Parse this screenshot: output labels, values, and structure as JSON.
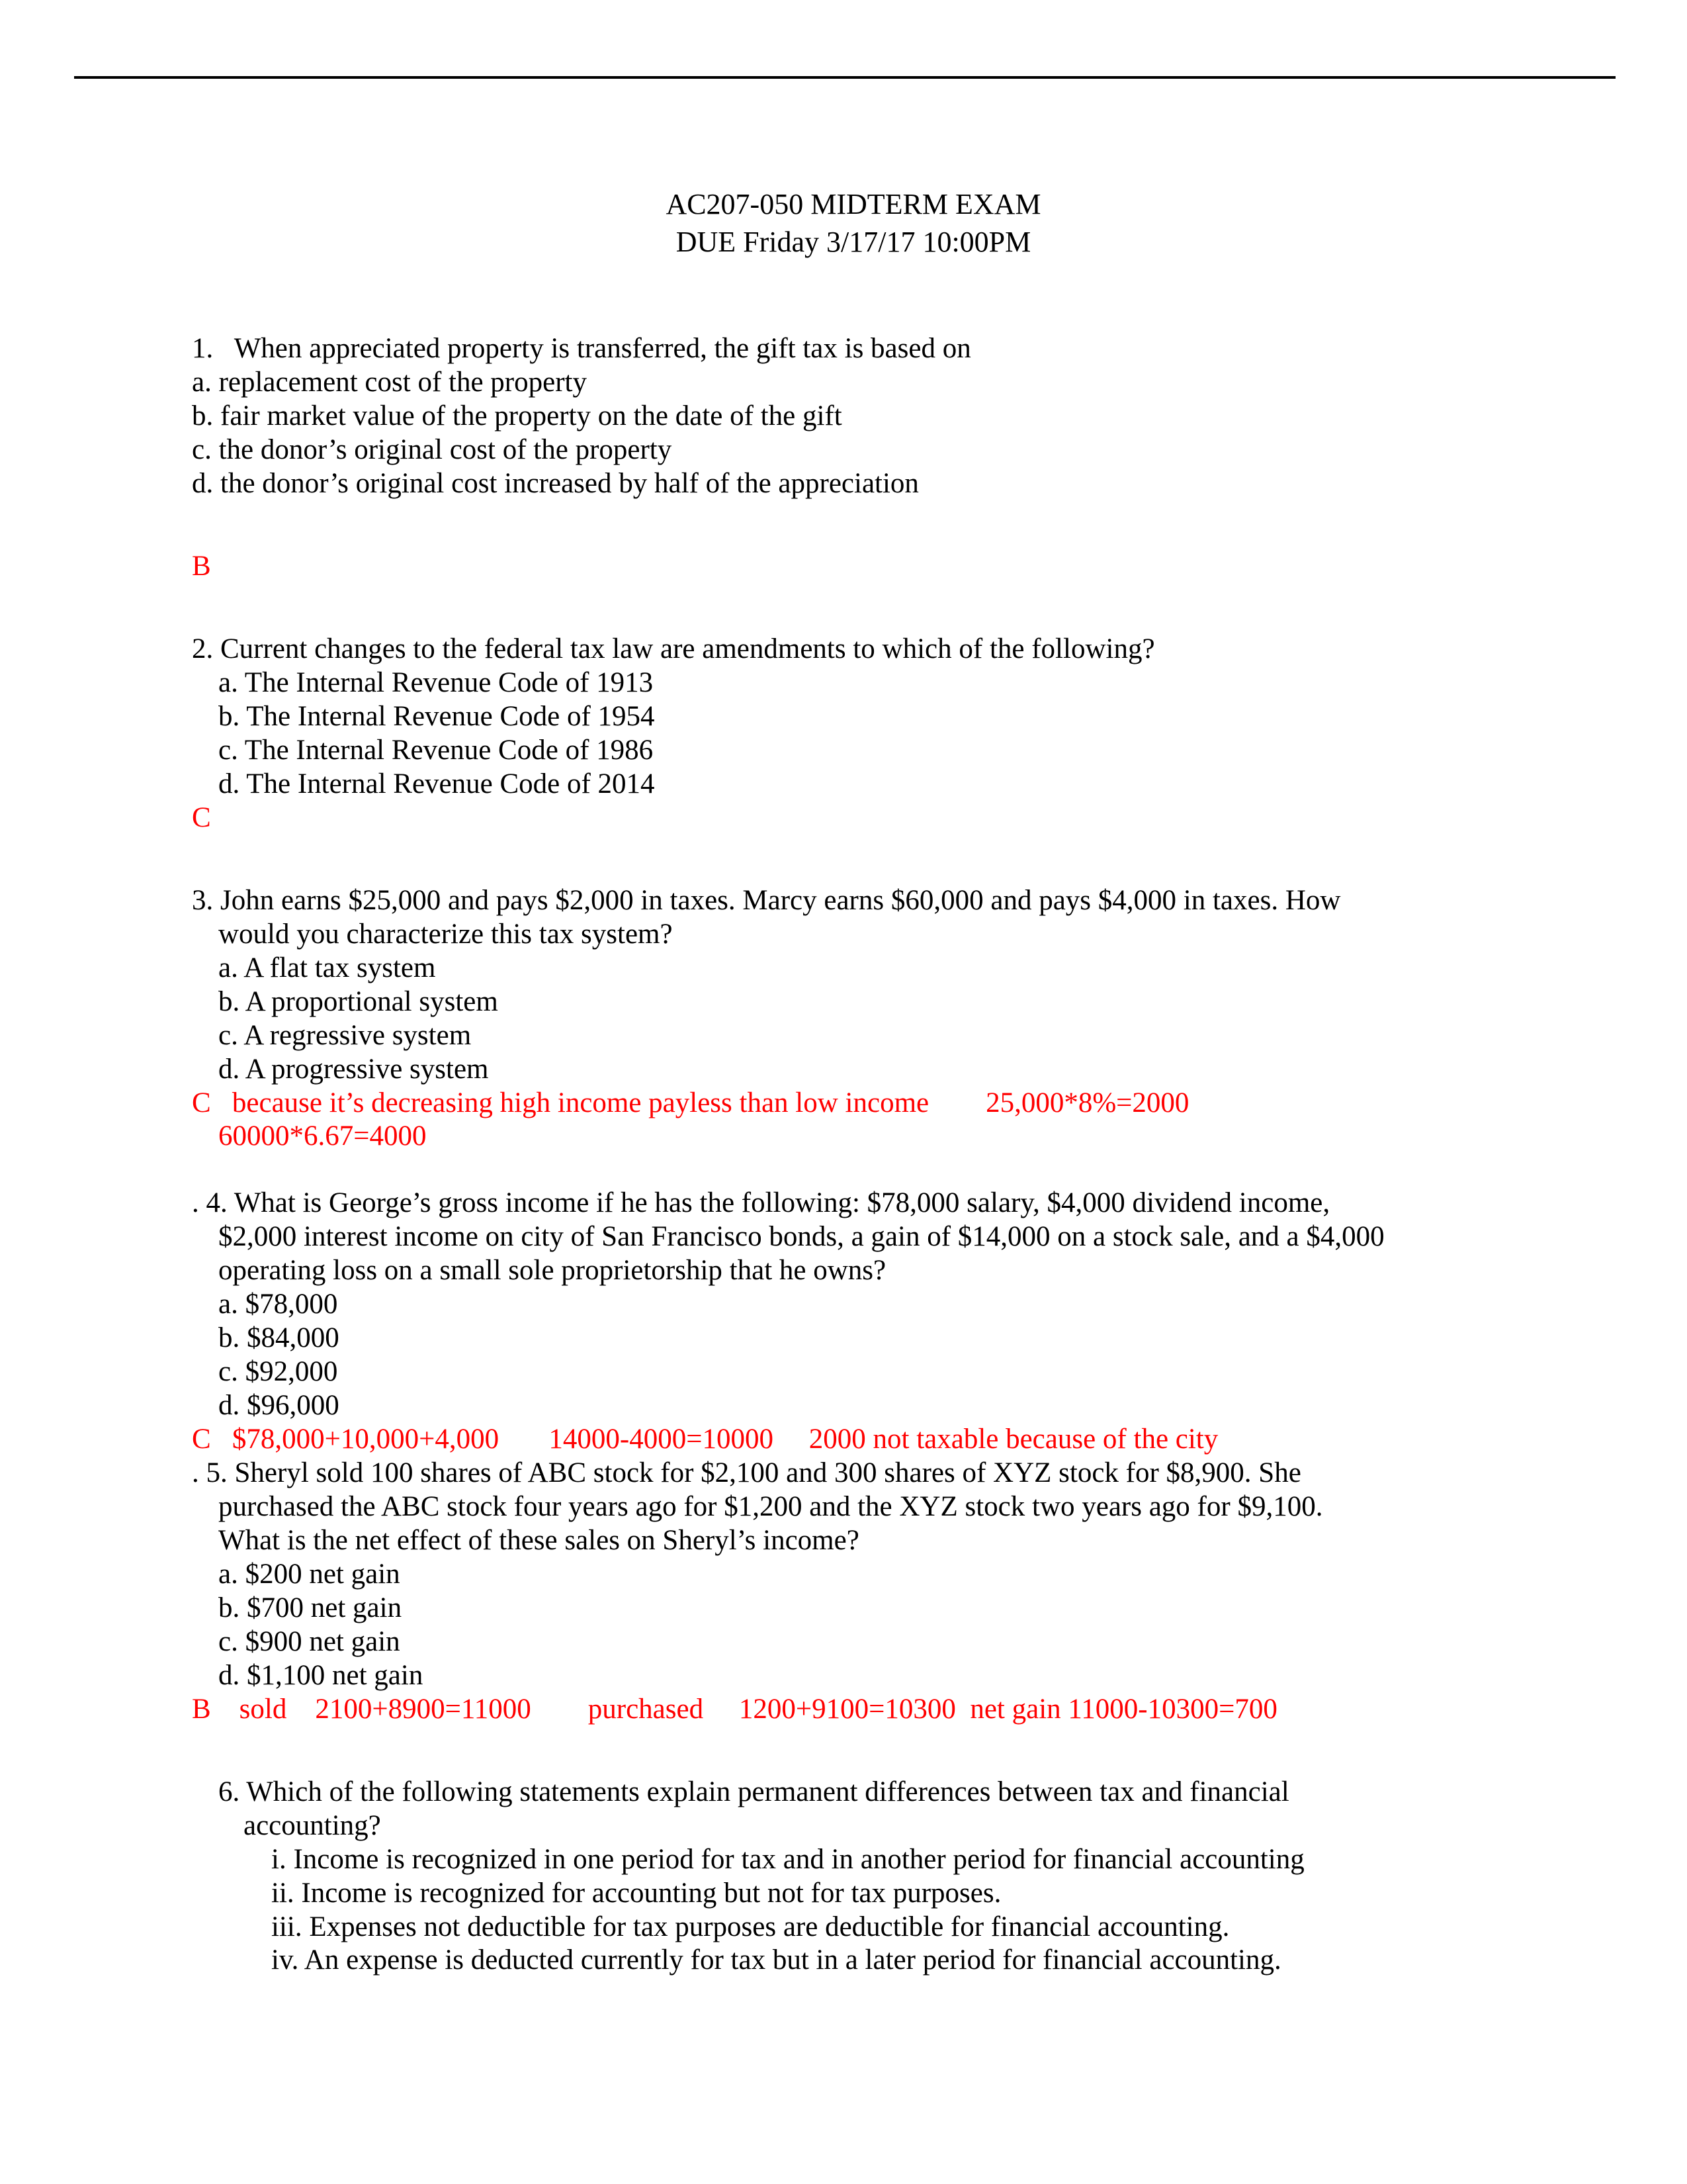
{
  "document": {
    "title_lines": [
      "AC207-050 MIDTERM EXAM",
      "DUE Friday 3/17/17 10:00PM"
    ]
  },
  "questions": [
    {
      "number": "1.",
      "stem": "1.   When appreciated property is transferred, the gift tax is based on",
      "options": [
        "a. replacement cost of the property",
        "b. fair market value of the property on the date of the gift",
        "c. the donor’s original cost of the property",
        "d. the donor’s original cost increased by half of the appreciation"
      ],
      "answer_lines": [
        "B"
      ]
    },
    {
      "number": "2.",
      "stem": "2. Current changes to the federal tax law are amendments to which of the following?",
      "options": [
        "a. The Internal Revenue Code of 1913",
        "b. The Internal Revenue Code of 1954",
        "c. The Internal Revenue Code of 1986",
        "d. The Internal Revenue Code of 2014"
      ],
      "answer_lines": [
        "C"
      ]
    },
    {
      "number": "3.",
      "stem_line_1": "3. John earns $25,000 and pays $2,000 in taxes. Marcy earns $60,000 and pays $4,000 in taxes. How",
      "stem_line_2": "would you characterize this tax system?",
      "options": [
        "a. A flat tax system",
        "b. A proportional system",
        "c. A regressive system",
        "d. A progressive system"
      ],
      "answer_lines": [
        "C   because it’s decreasing high income payless than low income        25,000*8%=2000",
        "60000*6.67=4000"
      ]
    },
    {
      "number": "4.",
      "stem_line_1": ". 4. What is George’s gross income if he has the following: $78,000 salary, $4,000 dividend income,",
      "stem_line_2": "$2,000 interest income on city of San Francisco bonds, a gain of $14,000 on a stock sale, and a $4,000",
      "stem_line_3": "operating loss on a small sole proprietorship that he owns?",
      "options": [
        "a. $78,000",
        "b. $84,000",
        "c. $92,000",
        "d. $96,000"
      ],
      "answer_lines": [
        "C   $78,000+10,000+4,000       14000-4000=10000     2000 not taxable because of the city"
      ]
    },
    {
      "number": "5.",
      "stem_line_1": ". 5. Sheryl sold 100 shares of ABC stock for $2,100 and 300 shares of XYZ stock for $8,900. She",
      "stem_line_2": "purchased the ABC stock four years ago for $1,200 and the XYZ stock two years ago for $9,100.",
      "stem_line_3": "What is the net effect of these sales on Sheryl’s income?",
      "options": [
        "a. $200 net gain",
        "b. $700 net gain",
        "c. $900 net gain",
        "d. $1,100 net gain"
      ],
      "answer_lines": [
        "B    sold    2100+8900=11000        purchased     1200+9100=10300  net gain 11000-10300=700"
      ]
    },
    {
      "number": "6.",
      "stem_line_1": "6. Which of the following statements explain permanent differences between tax and financial",
      "stem_line_2": "accounting?",
      "options": [
        "i. Income is recognized in one period for tax and in another period for financial accounting",
        "ii. Income is recognized for accounting but not for tax purposes.",
        "iii. Expenses not deductible for tax purposes are deductible for financial accounting.",
        "iv. An expense is deducted currently for tax but in a later period for financial accounting."
      ],
      "answer_lines": []
    }
  ],
  "colors": {
    "answer_red": "#ff0000",
    "text_black": "#000000",
    "page_background": "#ffffff"
  }
}
